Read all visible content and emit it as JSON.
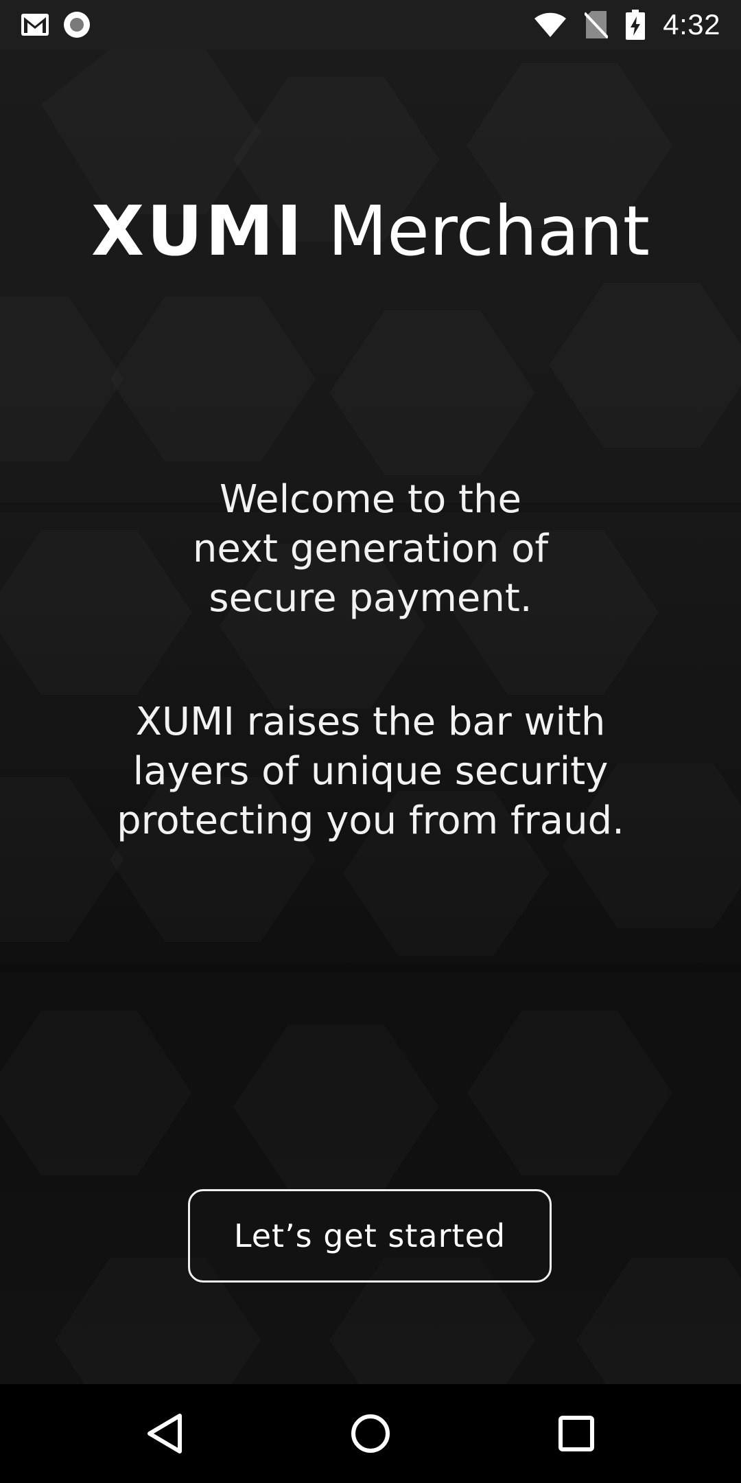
{
  "status_bar": {
    "time": "4:32",
    "left_icons": [
      "gmail-icon",
      "record-icon"
    ],
    "right_icons": [
      "wifi-icon",
      "no-sim-icon",
      "battery-charging-icon"
    ]
  },
  "logo": {
    "brand": "XUMI",
    "product": "Merchant"
  },
  "welcome": {
    "lines": [
      "Welcome to the",
      "next generation of",
      "secure payment."
    ]
  },
  "subtitle": {
    "lines": [
      "XUMI raises the bar with",
      "layers of unique security",
      "protecting you from fraud."
    ]
  },
  "cta": {
    "label": "Let’s get started"
  },
  "nav_bar": {
    "icons": [
      "back-icon",
      "home-icon",
      "recents-icon"
    ]
  },
  "colors": {
    "background": "#161616",
    "text": "#ffffff",
    "nav_bar": "#000000",
    "button_border": "#f0f0f0"
  }
}
